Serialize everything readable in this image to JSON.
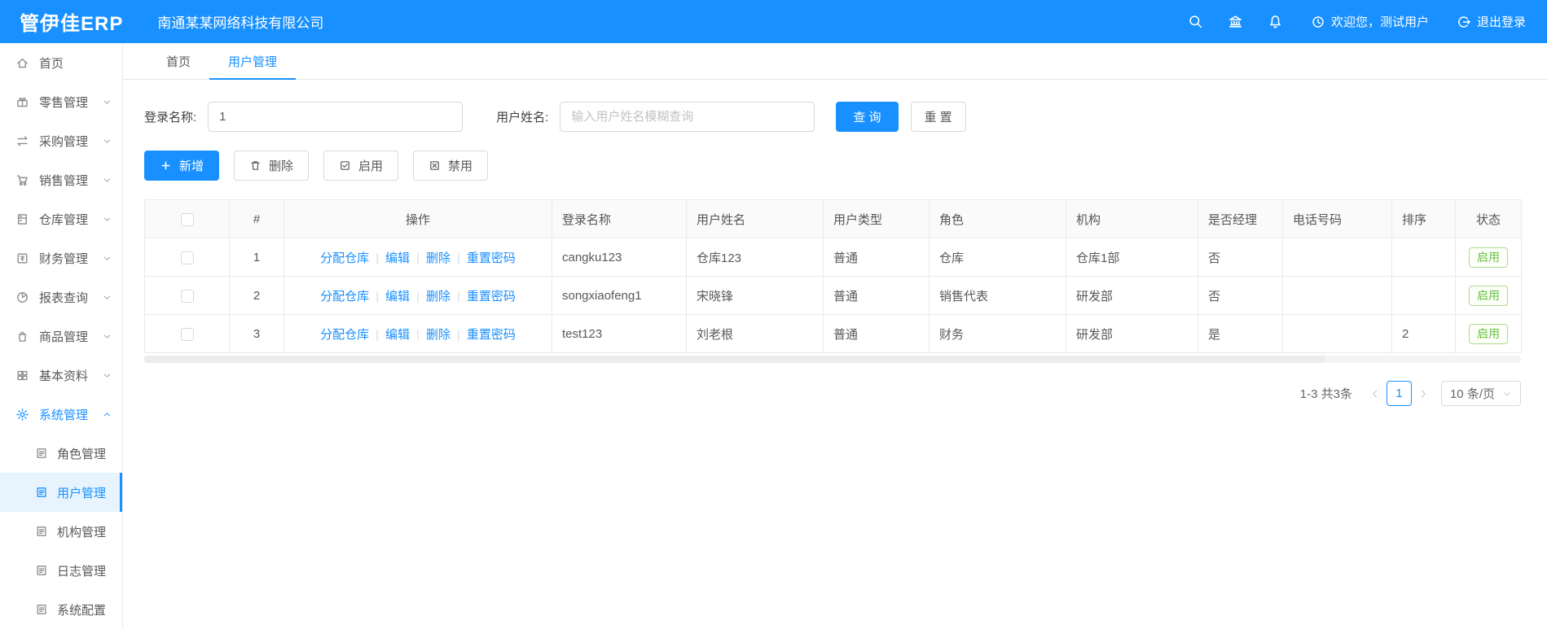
{
  "header": {
    "logo": "管伊佳ERP",
    "company": "南通某某网络科技有限公司",
    "welcome": "欢迎您，测试用户",
    "logout": "退出登录"
  },
  "sidebar": {
    "items": [
      {
        "label": "首页",
        "icon": "home-icon"
      },
      {
        "label": "零售管理",
        "icon": "retail-icon"
      },
      {
        "label": "采购管理",
        "icon": "purchase-icon"
      },
      {
        "label": "销售管理",
        "icon": "sales-cart-icon"
      },
      {
        "label": "仓库管理",
        "icon": "warehouse-icon"
      },
      {
        "label": "财务管理",
        "icon": "finance-icon"
      },
      {
        "label": "报表查询",
        "icon": "report-pie-icon"
      },
      {
        "label": "商品管理",
        "icon": "product-bag-icon"
      },
      {
        "label": "基本资料",
        "icon": "basic-data-grid-icon"
      },
      {
        "label": "系统管理",
        "icon": "system-gear-icon",
        "active": true
      }
    ],
    "subitems": [
      {
        "label": "角色管理"
      },
      {
        "label": "用户管理",
        "active": true
      },
      {
        "label": "机构管理"
      },
      {
        "label": "日志管理"
      },
      {
        "label": "系统配置"
      }
    ]
  },
  "tabs": [
    {
      "label": "首页"
    },
    {
      "label": "用户管理",
      "active": true
    }
  ],
  "search": {
    "login_label": "登录名称:",
    "login_value": "1",
    "name_label": "用户姓名:",
    "name_placeholder": "输入用户姓名模糊查询",
    "query_label": "查 询",
    "reset_label": "重 置"
  },
  "toolbar": {
    "add": "新增",
    "delete": "删除",
    "enable": "启用",
    "disable": "禁用"
  },
  "table": {
    "headers": [
      "#",
      "操作",
      "登录名称",
      "用户姓名",
      "用户类型",
      "角色",
      "机构",
      "是否经理",
      "电话号码",
      "排序",
      "状态"
    ],
    "op_links": [
      "分配仓库",
      "编辑",
      "删除",
      "重置密码"
    ],
    "rows": [
      {
        "num": "1",
        "login": "cangku123",
        "name": "仓库123",
        "type": "普通",
        "role": "仓库",
        "org": "仓库1部",
        "manager": "否",
        "phone": "",
        "sort": "",
        "status": "启用"
      },
      {
        "num": "2",
        "login": "songxiaofeng1",
        "name": "宋晓锋",
        "type": "普通",
        "role": "销售代表",
        "org": "研发部",
        "manager": "否",
        "phone": "",
        "sort": "",
        "status": "启用"
      },
      {
        "num": "3",
        "login": "test123",
        "name": "刘老根",
        "type": "普通",
        "role": "财务",
        "org": "研发部",
        "manager": "是",
        "phone": "",
        "sort": "2",
        "status": "启用"
      }
    ]
  },
  "pagination": {
    "total": "1-3 共3条",
    "page": "1",
    "per_page": "10 条/页"
  },
  "colors": {
    "accent": "#1890ff",
    "success": "#6abf40",
    "header_bg": "#1890ff"
  }
}
